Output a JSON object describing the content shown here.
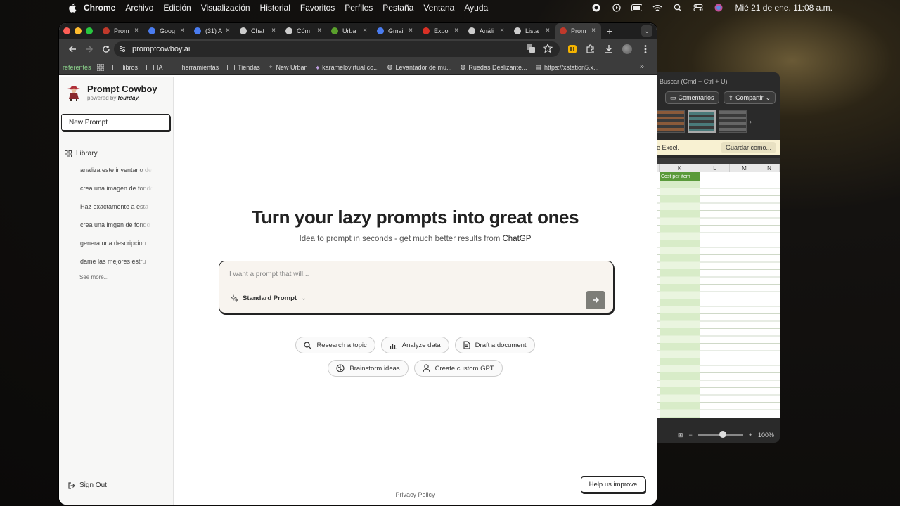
{
  "menubar": {
    "items": [
      "Chrome",
      "Archivo",
      "Edición",
      "Visualización",
      "Historial",
      "Favoritos",
      "Perfiles",
      "Pestaña",
      "Ventana",
      "Ayuda"
    ],
    "clock": "Mié 21 de ene.  11:08 a.m."
  },
  "excel": {
    "search": "Buscar (Cmd + Ctrl + U)",
    "comments": "Comentarios",
    "share": "Compartir",
    "bar_text": "e Excel.",
    "save_as": "Guardar como...",
    "cols": [
      "K",
      "L",
      "M",
      "N"
    ],
    "header_cell": "Cost per item",
    "zoom": "100%"
  },
  "tabs": [
    {
      "title": "Prom",
      "fav": "#c0392b"
    },
    {
      "title": "Goog",
      "fav": "#4a7cf0"
    },
    {
      "title": "(31) A",
      "fav": "#4a7cf0"
    },
    {
      "title": "Chat",
      "fav": "#ccc"
    },
    {
      "title": "Cóm",
      "fav": "#ccc"
    },
    {
      "title": "Urba",
      "fav": "#5aa02c"
    },
    {
      "title": "Gmai",
      "fav": "#4a7cf0"
    },
    {
      "title": "Expo",
      "fav": "#d93025"
    },
    {
      "title": "Análi",
      "fav": "#ccc"
    },
    {
      "title": "Lista",
      "fav": "#ccc"
    },
    {
      "title": "Prom",
      "fav": "#c0392b",
      "active": true
    }
  ],
  "address": "promptcowboy.ai",
  "bookmarks": {
    "referentes": "referentes",
    "items": [
      "libros",
      "IA",
      "herramientas",
      "Tiendas",
      "New Urban",
      "karamelovirtual.co...",
      "Levantador de mu...",
      "Ruedas Deslizante...",
      "https://xstation5.x..."
    ]
  },
  "sidebar": {
    "brand": "Prompt Cowboy",
    "powered_by": "powered by",
    "powered_brand": "fourday.",
    "new_prompt": "New Prompt",
    "library": "Library",
    "items": [
      "analiza este inventario de",
      "crea una imagen de fondo",
      "Haz exactamente a esta",
      "crea una imgen de fondo",
      "genera una descripcion",
      "dame las mejores estru"
    ],
    "see_more": "See more...",
    "sign_out": "Sign Out"
  },
  "main": {
    "title": "Turn your lazy prompts into great ones",
    "subtitle": "Idea to prompt in seconds - get much better results from",
    "subtitle_brand": "ChatGP",
    "placeholder": "I want a prompt that will...",
    "mode": "Standard Prompt",
    "chips_row1": [
      "Research a topic",
      "Analyze data",
      "Draft a document"
    ],
    "chips_row2": [
      "Brainstorm ideas",
      "Create custom GPT"
    ],
    "privacy": "Privacy Policy",
    "help": "Help us improve"
  }
}
